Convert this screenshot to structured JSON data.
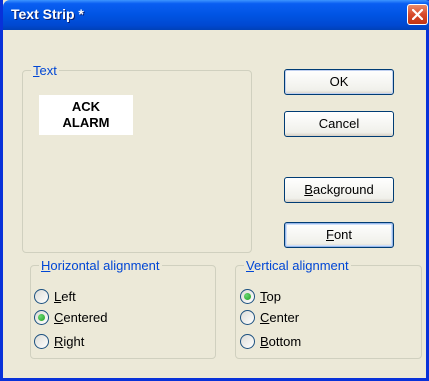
{
  "window": {
    "title": "Text Strip *"
  },
  "text_group": {
    "legend_first": "T",
    "legend_rest": "ext",
    "preview_line1": "ACK",
    "preview_line2": "ALARM"
  },
  "buttons": {
    "ok": "OK",
    "cancel": "Cancel",
    "background_first": "B",
    "background_rest": "ackground",
    "font_first": "F",
    "font_rest": "ont"
  },
  "horizontal": {
    "legend_first": "H",
    "legend_rest": "orizontal alignment",
    "options": [
      {
        "first": "L",
        "rest": "eft",
        "checked": false
      },
      {
        "first": "C",
        "rest": "entered",
        "checked": true
      },
      {
        "first": "R",
        "rest": "ight",
        "checked": false
      }
    ]
  },
  "vertical": {
    "legend_first": "V",
    "legend_rest": "ertical alignment",
    "options": [
      {
        "first": "T",
        "rest": "op",
        "checked": true
      },
      {
        "first": "C",
        "rest": "enter",
        "checked": false
      },
      {
        "first": "B",
        "rest": "ottom",
        "checked": false
      }
    ]
  }
}
